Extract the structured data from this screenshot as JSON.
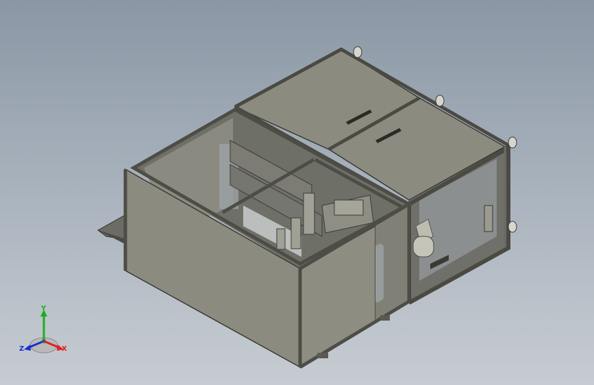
{
  "viewport": {
    "background_top": "#8b97a5",
    "background_bottom": "#c7ccd2"
  },
  "model": {
    "panel_color": "#84847a",
    "frame_color": "#55554d",
    "edge_color": "#3a3a34"
  },
  "triad": {
    "x_label": "X",
    "y_label": "Y",
    "z_label": "Z",
    "x_color": "#e02020",
    "y_color": "#18b018",
    "z_color": "#1a2fd0"
  }
}
